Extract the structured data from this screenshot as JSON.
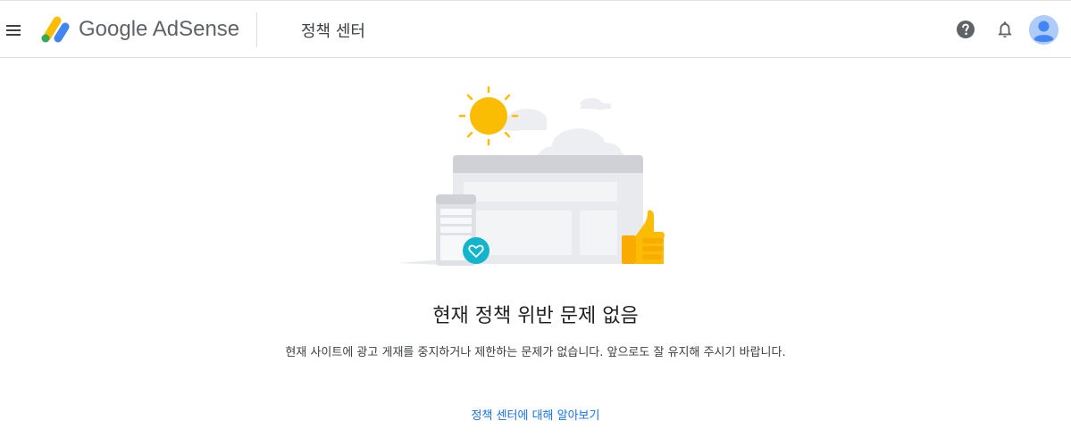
{
  "header": {
    "menu_icon": "hamburger-menu-icon",
    "logo_text": "Google AdSense",
    "page_title": "정책 센터",
    "help_icon": "help-circle-icon",
    "notifications_icon": "bell-icon",
    "avatar_icon": "account-avatar-icon"
  },
  "main": {
    "illustration_icon": "website-approved-illustration",
    "title": "현재 정책 위반 문제 없음",
    "description": "현재 사이트에 광고 게재를 중지하거나 제한하는 문제가 없습니다. 앞으로도 잘 유지해 주시기 바랍니다.",
    "learn_more_link": "정책 센터에 대해 알아보기"
  },
  "colors": {
    "brand_yellow": "#fbbc04",
    "brand_blue": "#4285f4",
    "brand_green": "#34a853",
    "link_blue": "#1a73e8",
    "teal_badge": "#12b5cb"
  }
}
